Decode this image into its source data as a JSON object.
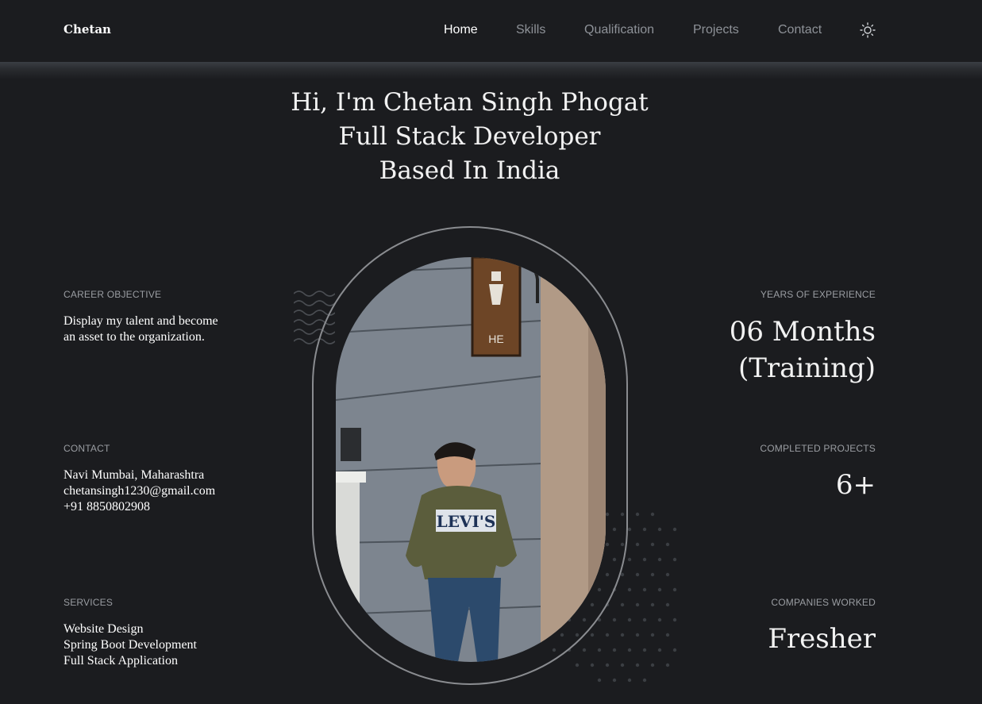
{
  "nav": {
    "logo": "Chetan",
    "links": [
      "Home",
      "Skills",
      "Qualification",
      "Projects",
      "Contact"
    ],
    "active": "Home",
    "theme_icon": "sun-icon"
  },
  "hero": {
    "lines": [
      "Hi, I'm Chetan Singh Phogat",
      "Full Stack Developer",
      "Based In India"
    ]
  },
  "left": {
    "career": {
      "label": "CAREER OBJECTIVE",
      "text": [
        "Display my talent and become",
        "an asset to the organization."
      ]
    },
    "contact": {
      "label": "CONTACT",
      "lines": [
        "Navi Mumbai, Maharashtra",
        "chetansingh1230@gmail.com",
        "+91 8850802908"
      ]
    },
    "services": {
      "label": "SERVICES",
      "lines": [
        "Website Design",
        "Spring Boot Development",
        "Full Stack Application"
      ]
    }
  },
  "right": {
    "experience": {
      "label": "YEARS OF EXPERIENCE",
      "value": [
        "06 Months",
        "(Training)"
      ]
    },
    "projects": {
      "label": "COMPLETED PROJECTS",
      "value": "6+"
    },
    "companies": {
      "label": "COMPANIES WORKED",
      "value": "Fresher"
    }
  },
  "photo": {
    "sign_text": "HE",
    "shirt_text": "LEVI'S"
  },
  "colors": {
    "background": "#1b1c1f",
    "muted": "#9a9da2",
    "frame": "#8a8c90",
    "text": "#ffffff"
  }
}
